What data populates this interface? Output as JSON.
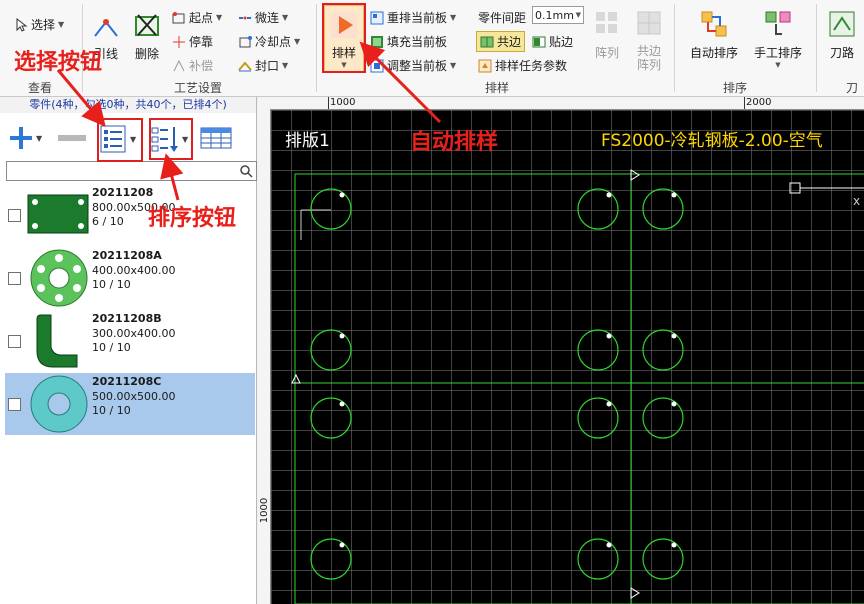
{
  "ribbon": {
    "view_group": {
      "label": "查看",
      "select": "选择"
    },
    "process_group": {
      "label": "工艺设置",
      "lead": "引线",
      "delete": "删除",
      "start_point": "起点",
      "stop": "停靠",
      "compensate": "补偿",
      "micro_link": "微连",
      "cooling_point": "冷却点",
      "seal": "封口"
    },
    "nest_group": {
      "label": "排样",
      "nest": "排样",
      "renest": "重排当前板",
      "fill": "填充当前板",
      "adjust": "调整当前板",
      "spacing_label": "零件间距",
      "spacing_value": "0.1mm",
      "common_edge": "共边",
      "stick_edge": "贴边",
      "nest_task_params": "排样任务参数",
      "array": "阵列",
      "common_array": "共边\n阵列"
    },
    "sort_group": {
      "label": "排序",
      "auto_sort": "自动排序",
      "manual_sort": "手工排序"
    },
    "tool_group": {
      "tool_path": "刀路",
      "label": "刀"
    }
  },
  "sidebar": {
    "header": "零件(4种，勾选0种，共40个，已排4个)",
    "search_placeholder": "",
    "parts": [
      {
        "name": "20211208",
        "size": "800.00x500.00",
        "count": "6 / 10",
        "shape": "rect-plate",
        "color": "#1b7a2c"
      },
      {
        "name": "20211208A",
        "size": "400.00x400.00",
        "count": "10 / 10",
        "shape": "ring-plate",
        "color": "#5cc35c"
      },
      {
        "name": "20211208B",
        "size": "300.00x400.00",
        "count": "10 / 10",
        "shape": "l-bracket",
        "color": "#1b7a2c"
      },
      {
        "name": "20211208C",
        "size": "500.00x500.00",
        "count": "10 / 10",
        "shape": "ring",
        "color": "#5dc9c9"
      }
    ]
  },
  "ruler": {
    "h_ticks": [
      "1000",
      "2000"
    ],
    "v_ticks": [
      "1000"
    ]
  },
  "canvas": {
    "sheet_title": "排版1",
    "sheet_info": "FS2000-冷轧钢板-2.00-空气",
    "axis_x": "x",
    "colors": {
      "sheet_border": "#2fd62f",
      "circles": "#2fd62f",
      "info_text": "#ffd700",
      "title_text": "#ffffff"
    }
  },
  "annotations": {
    "select_button": "选择按钮",
    "sort_button": "排序按钮",
    "auto_nest": "自动排样",
    "color": "#e8201c"
  }
}
